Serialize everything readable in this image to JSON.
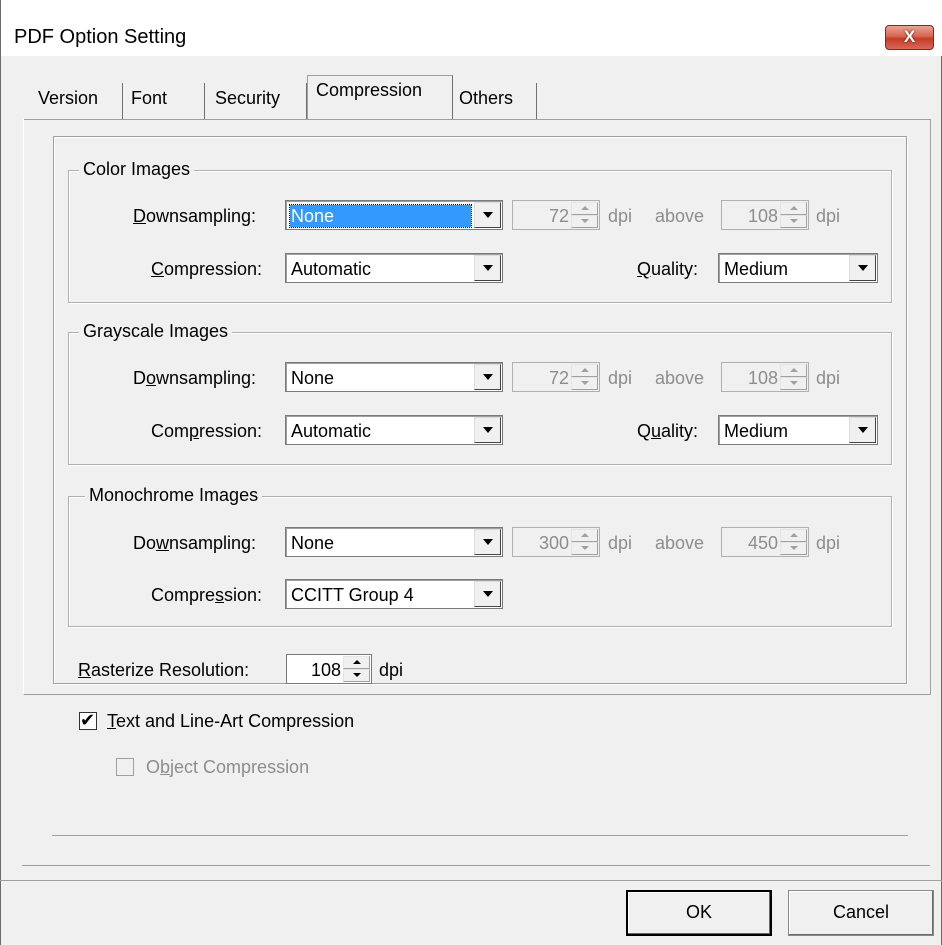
{
  "window": {
    "title": "PDF Option Setting",
    "close_label": "X"
  },
  "tabs": [
    {
      "label": "Version"
    },
    {
      "label": "Font"
    },
    {
      "label": "Security"
    },
    {
      "label": "Compression",
      "active": true
    },
    {
      "label": "Others"
    }
  ],
  "color_images": {
    "title": "Color Images",
    "downsampling_label_pre": "",
    "downsampling_label_u": "D",
    "downsampling_label_post": "ownsampling:",
    "downsampling_value": "None",
    "dpi_value": "72",
    "dpi_unit": "dpi",
    "above_label": "above",
    "above_value": "108",
    "above_unit": "dpi",
    "compression_label_u": "C",
    "compression_label_post": "ompression:",
    "compression_value": "Automatic",
    "quality_label_u": "Q",
    "quality_label_post": "uality:",
    "quality_value": "Medium"
  },
  "grayscale_images": {
    "title": "Grayscale Images",
    "downsampling_label_pre": "D",
    "downsampling_label_u": "o",
    "downsampling_label_post": "wnsampling:",
    "downsampling_value": "None",
    "dpi_value": "72",
    "dpi_unit": "dpi",
    "above_label": "above",
    "above_value": "108",
    "above_unit": "dpi",
    "compression_label_pre": "Com",
    "compression_label_u": "p",
    "compression_label_post": "ression:",
    "compression_value": "Automatic",
    "quality_label_pre": "Q",
    "quality_label_u": "u",
    "quality_label_post": "ality:",
    "quality_value": "Medium"
  },
  "monochrome_images": {
    "title": "Monochrome Images",
    "downsampling_label_pre": "Do",
    "downsampling_label_u": "w",
    "downsampling_label_post": "nsampling:",
    "downsampling_value": "None",
    "dpi_value": "300",
    "dpi_unit": "dpi",
    "above_label": "above",
    "above_value": "450",
    "above_unit": "dpi",
    "compression_label_pre": "Compre",
    "compression_label_u": "s",
    "compression_label_post": "sion:",
    "compression_value": "CCITT Group 4"
  },
  "rasterize": {
    "label_u": "R",
    "label_post": "asterize Resolution:",
    "value": "108",
    "unit": "dpi"
  },
  "text_lineart": {
    "label_u": "T",
    "label_post": "ext and Line-Art Compression",
    "checked": true
  },
  "object_compression": {
    "label_pre": "O",
    "label_u": "b",
    "label_post": "ject Compression",
    "checked": false,
    "enabled": false
  },
  "buttons": {
    "ok": "OK",
    "cancel": "Cancel"
  }
}
